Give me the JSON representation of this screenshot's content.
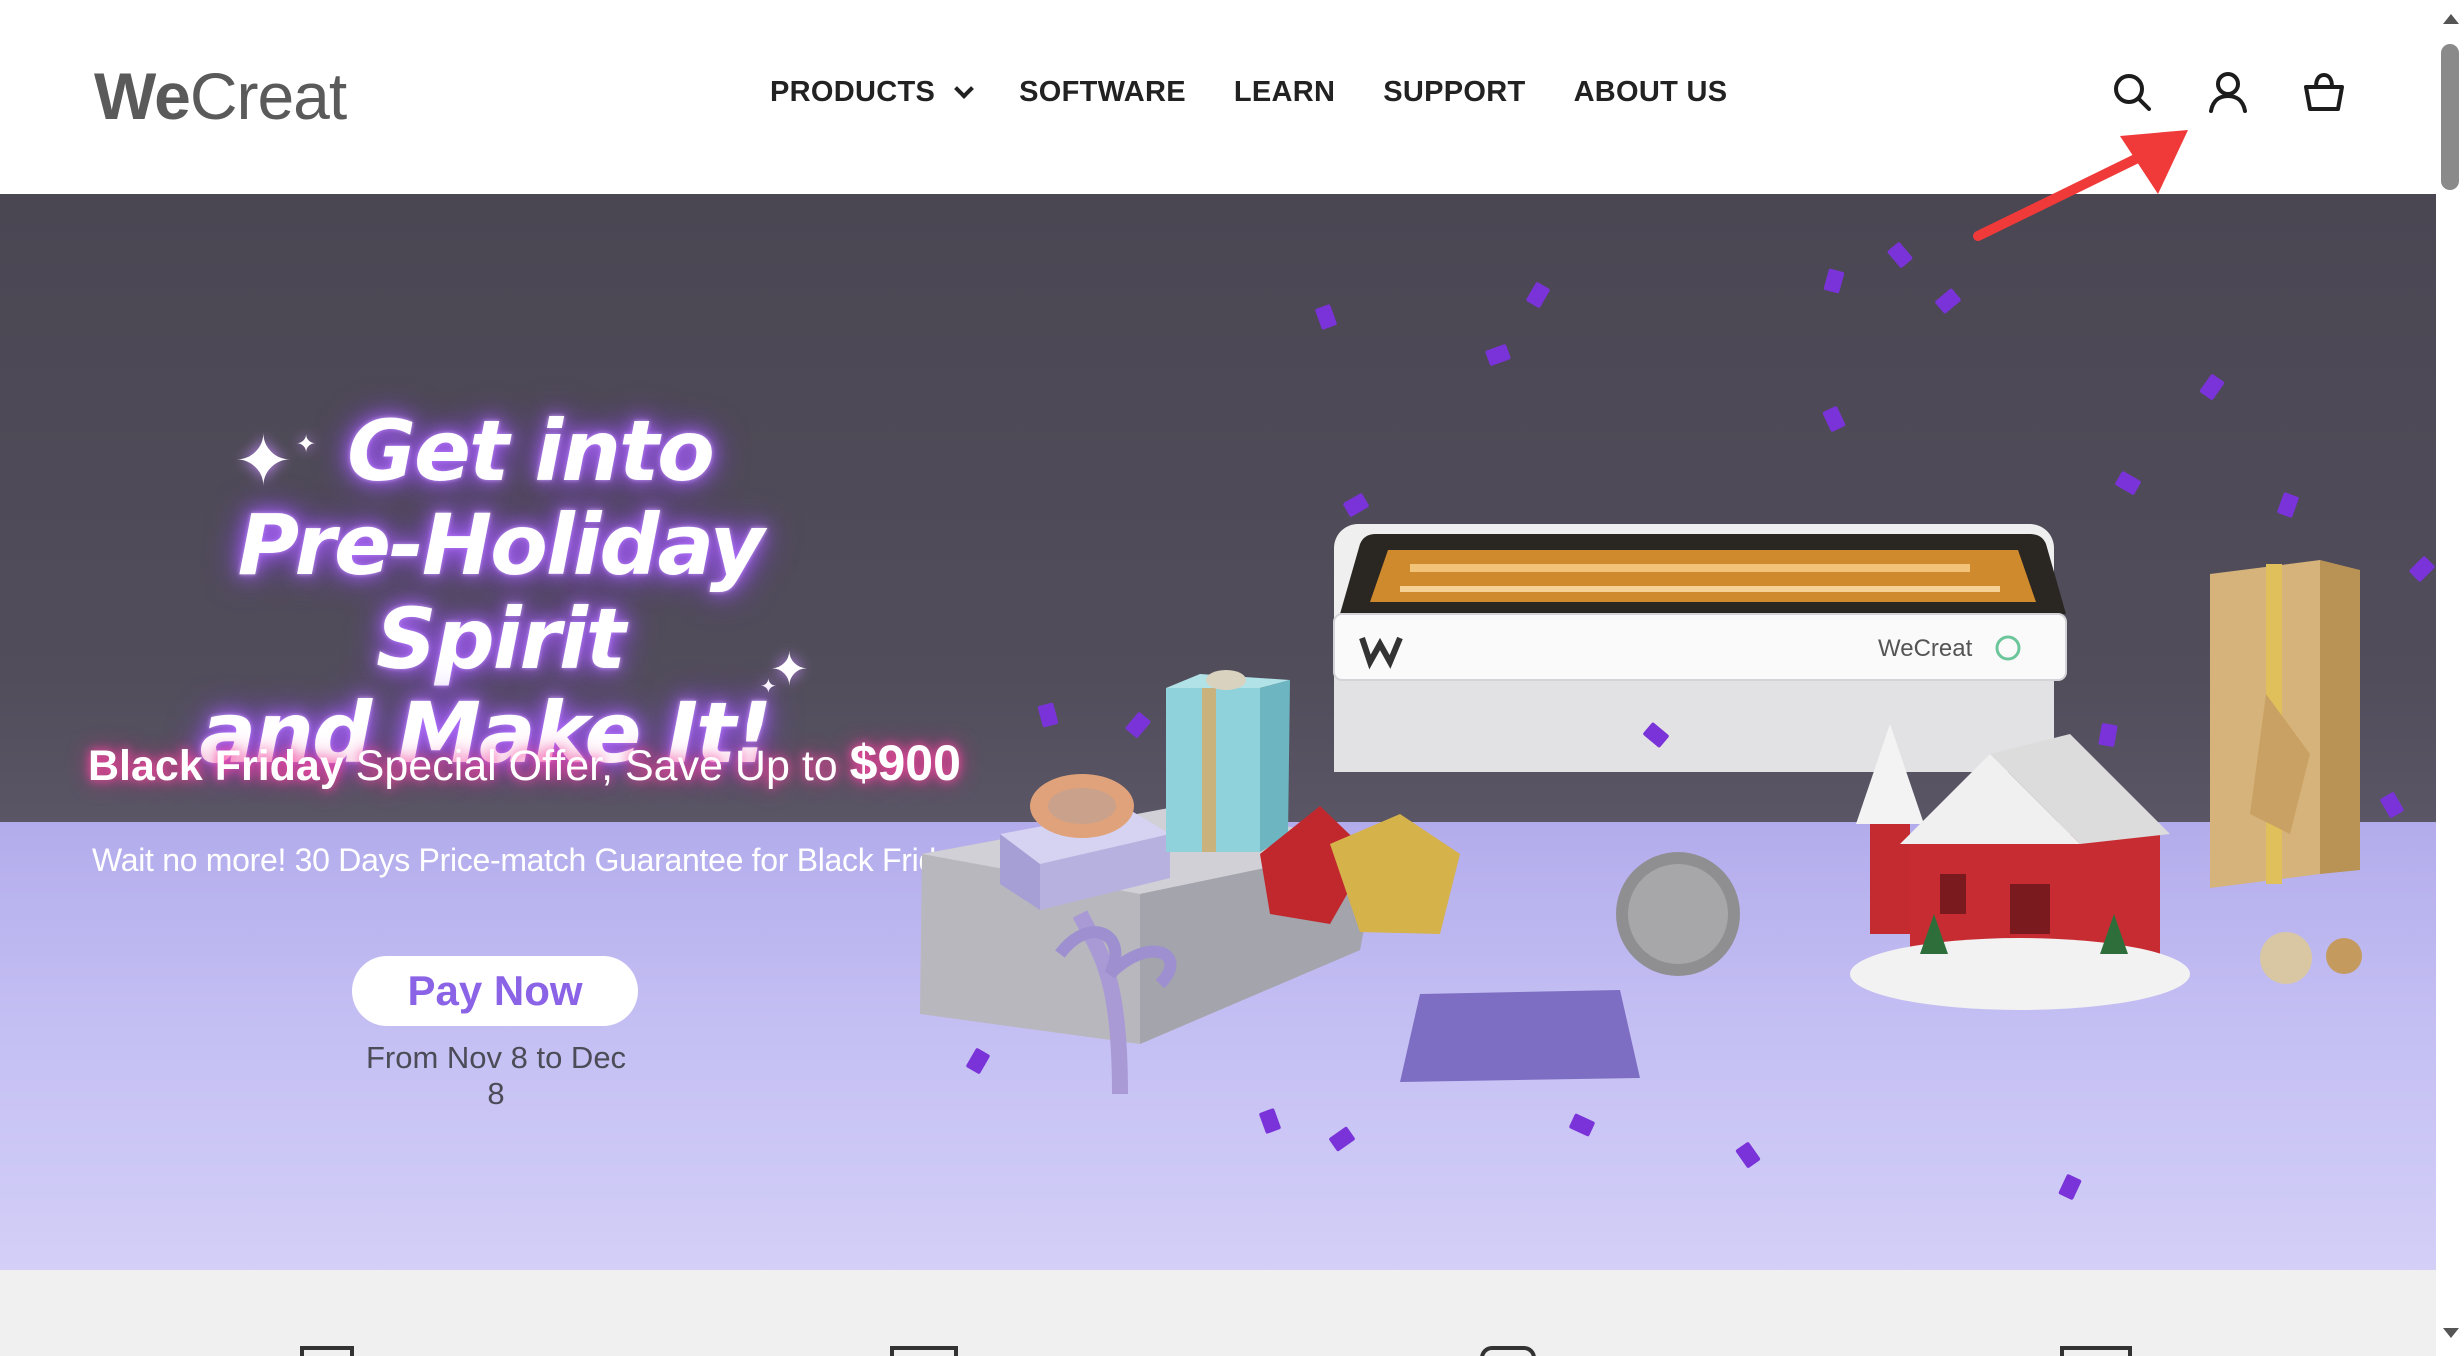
{
  "header": {
    "logo_we": "We",
    "logo_creat": "Creat",
    "nav": [
      {
        "label": "PRODUCTS"
      },
      {
        "label": "SOFTWARE"
      },
      {
        "label": "LEARN"
      },
      {
        "label": "SUPPORT"
      },
      {
        "label": "ABOUT US"
      }
    ],
    "icons": [
      "search-icon",
      "account-icon",
      "cart-icon"
    ]
  },
  "hero": {
    "headline_line1": "Get into",
    "headline_line2": "Pre-Holiday Spirit",
    "headline_line3": "and Make It!",
    "offer_prefix": "Black Friday",
    "offer_middle": " Special Offer, Save Up to ",
    "offer_amount": "$900",
    "guarantee": "Wait no more! 30 Days Price-match Guarantee for Black Friday",
    "cta": "Pay Now",
    "dates": "From Nov 8 to Dec 8",
    "machine_brand": "WeCreat"
  },
  "colors": {
    "accent": "#8a63e6",
    "annotation_arrow": "#f03a3a",
    "confetti": "#7a33d8"
  }
}
